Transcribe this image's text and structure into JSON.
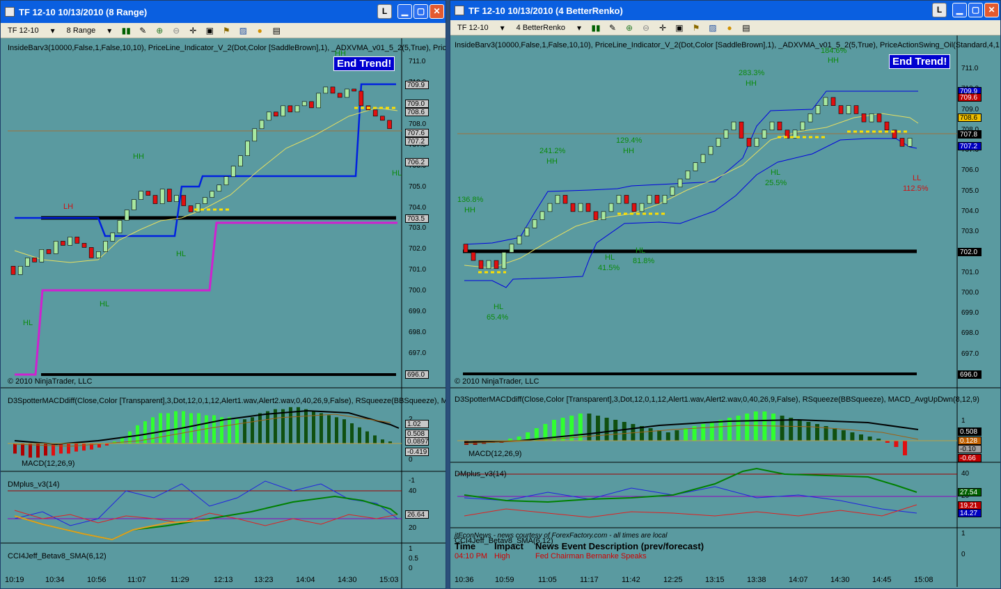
{
  "left": {
    "title": "TF 12-10  10/13/2010 (8 Range)",
    "btn_l": "L",
    "toolbar": {
      "instrument": "TF 12-10",
      "period": "8 Range"
    },
    "indicator_line": "InsideBarv3(10000,False,1,False,10,10),  PriceLine_Indicator_V_2(Dot,Color [SaddleBrown],1),  _ADXVMA_v01_5_2(5,True),  Pric",
    "copyright": "© 2010 NinjaTrader, LLC",
    "end_trend": "End Trend!",
    "price_labels": [
      "711.0",
      "710.0",
      "709.0",
      "708.0",
      "707.0",
      "706.0",
      "705.0",
      "704.0",
      "703.0",
      "702.0",
      "701.0",
      "700.0",
      "699.0",
      "698.0",
      "697.0",
      "696.0"
    ],
    "price_tags": [
      "709.9",
      "709.0",
      "708.6",
      "707.6",
      "707.2",
      "706.2",
      "703.5",
      "696.0"
    ],
    "annotations": [
      {
        "text": "HH",
        "color": "#0a8a0a"
      },
      {
        "text": "HH",
        "color": "#0a8a0a"
      },
      {
        "text": "LH",
        "color": "#d01010"
      },
      {
        "text": "HL",
        "color": "#0a8a0a"
      },
      {
        "text": "HL",
        "color": "#0a8a0a"
      },
      {
        "text": "HL",
        "color": "#0a8a0a"
      },
      {
        "text": "HL",
        "color": "#0a8a0a"
      }
    ],
    "macd_line": "D3SpotterMACDdiff(Close,Color [Transparent],3,Dot,12,0,1,12,Alert1.wav,Alert2.wav,0,40,26,9,False), RSqueeze(BBSqueeze), M",
    "macd_label": "MACD(12,26,9)",
    "macd_ticks": [
      "2",
      "1",
      "0",
      "-1"
    ],
    "macd_tags": [
      "1.02",
      "0.508",
      "0.0897",
      "-0.419"
    ],
    "dm_line": "DMplus_v3(14)",
    "dm_ticks": [
      "40",
      "20"
    ],
    "dm_tags": [
      "26.64"
    ],
    "cci_line": "CCI4Jeff_Betav8_SMA(6,12)",
    "cci_ticks": [
      "1",
      "0.5",
      "0"
    ],
    "times": [
      "10:19",
      "10:34",
      "10:56",
      "11:07",
      "11:29",
      "12:13",
      "13:23",
      "14:04",
      "14:30",
      "15:03"
    ]
  },
  "right": {
    "title": "TF 12-10  10/13/2010 (4 BetterRenko)",
    "btn_l": "L",
    "toolbar": {
      "instrument": "TF 12-10",
      "period": "4 BetterRenko"
    },
    "indicator_line": "InsideBarv3(10000,False,1,False,10,10),  PriceLine_Indicator_V_2(Dot,Color [SaddleBrown],1),  _ADXVMA_v01_5_2(5,True),  PriceActionSwing_Oil(Standard,4,1",
    "copyright": "© 2010 NinjaTrader, LLC",
    "end_trend": "End Trend!",
    "price_labels": [
      "711.0",
      "710.0",
      "709.0",
      "708.0",
      "707.0",
      "706.0",
      "705.0",
      "704.0",
      "703.0",
      "702.0",
      "701.0",
      "700.0",
      "699.0",
      "698.0",
      "697.0",
      "696.0"
    ],
    "price_tags": [
      {
        "v": "709.9",
        "bg": "#0000c0",
        "fg": "#ffffff"
      },
      {
        "v": "709.6",
        "bg": "#c00000",
        "fg": "#ffffff"
      },
      {
        "v": "708.6",
        "bg": "#f0c000",
        "fg": "#000000"
      },
      {
        "v": "707.8",
        "bg": "#000000",
        "fg": "#ffffff"
      },
      {
        "v": "707.2",
        "bg": "#0000c0",
        "fg": "#ffffff"
      },
      {
        "v": "702.0",
        "bg": "#000000",
        "fg": "#ffffff"
      },
      {
        "v": "696.0",
        "bg": "#000000",
        "fg": "#ffffff"
      }
    ],
    "annotations": [
      {
        "text": "184.6%",
        "color": "#0a8a0a"
      },
      {
        "text": "HH",
        "color": "#0a8a0a"
      },
      {
        "text": "283.3%",
        "color": "#0a8a0a"
      },
      {
        "text": "HH",
        "color": "#0a8a0a"
      },
      {
        "text": "241.2%",
        "color": "#0a8a0a"
      },
      {
        "text": "HH",
        "color": "#0a8a0a"
      },
      {
        "text": "129.4%",
        "color": "#0a8a0a"
      },
      {
        "text": "HH",
        "color": "#0a8a0a"
      },
      {
        "text": "136.8%",
        "color": "#0a8a0a"
      },
      {
        "text": "HH",
        "color": "#0a8a0a"
      },
      {
        "text": "HL",
        "color": "#0a8a0a"
      },
      {
        "text": "25.5%",
        "color": "#0a8a0a"
      },
      {
        "text": "HL",
        "color": "#0a8a0a"
      },
      {
        "text": "41.5%",
        "color": "#0a8a0a"
      },
      {
        "text": "HL",
        "color": "#0a8a0a"
      },
      {
        "text": "81.8%",
        "color": "#0a8a0a"
      },
      {
        "text": "HL",
        "color": "#0a8a0a"
      },
      {
        "text": "65.4%",
        "color": "#0a8a0a"
      },
      {
        "text": "LL",
        "color": "#d01010"
      },
      {
        "text": "112.5%",
        "color": "#d01010"
      }
    ],
    "macd_line": "D3SpotterMACDdiff(Close,Color [Transparent],3,Dot,12,0,1,12,Alert1.wav,Alert2.wav,0,40,26,9,False), RSqueeze(BBSqueeze), MACD_AvgUpDwn(8,12,9)",
    "macd_label": "MACD(12,26,9)",
    "macd_ticks": [
      "1",
      "0"
    ],
    "macd_tags": [
      {
        "v": "0.508",
        "bg": "#000000",
        "fg": "#ffffff"
      },
      {
        "v": "0.128",
        "bg": "#c06000",
        "fg": "#ffffff"
      },
      {
        "v": "-0.10",
        "bg": "#a0a0a0",
        "fg": "#000000"
      },
      {
        "v": "-0.66",
        "bg": "#c00000",
        "fg": "#ffffff"
      }
    ],
    "dm_line": "DMplus_v3(14)",
    "dm_ticks": [
      "40",
      "20"
    ],
    "dm_tags": [
      {
        "v": "27.54",
        "bg": "#006000",
        "fg": "#ffffff"
      },
      {
        "v": "19.21",
        "bg": "#c00000",
        "fg": "#ffffff"
      },
      {
        "v": "14.27",
        "bg": "#0000c0",
        "fg": "#ffffff"
      }
    ],
    "news": {
      "header": "jtEconNews - news courtesy of ForexFactory.com - all times are local",
      "cci": "CCI4Jeff_Betav8_SMA(6,12)",
      "col_time": "Time",
      "col_impact": "Impact",
      "col_desc": "News Event Description (prev/forecast)",
      "row_time": "04:10 PM",
      "row_impact": "High",
      "row_desc": "Fed Chairman Bernanke Speaks"
    },
    "cci_ticks": [
      "1",
      "0"
    ],
    "times": [
      "10:36",
      "10:59",
      "11:05",
      "11:17",
      "11:42",
      "12:25",
      "13:15",
      "13:38",
      "14:07",
      "14:30",
      "14:45",
      "15:08"
    ]
  }
}
